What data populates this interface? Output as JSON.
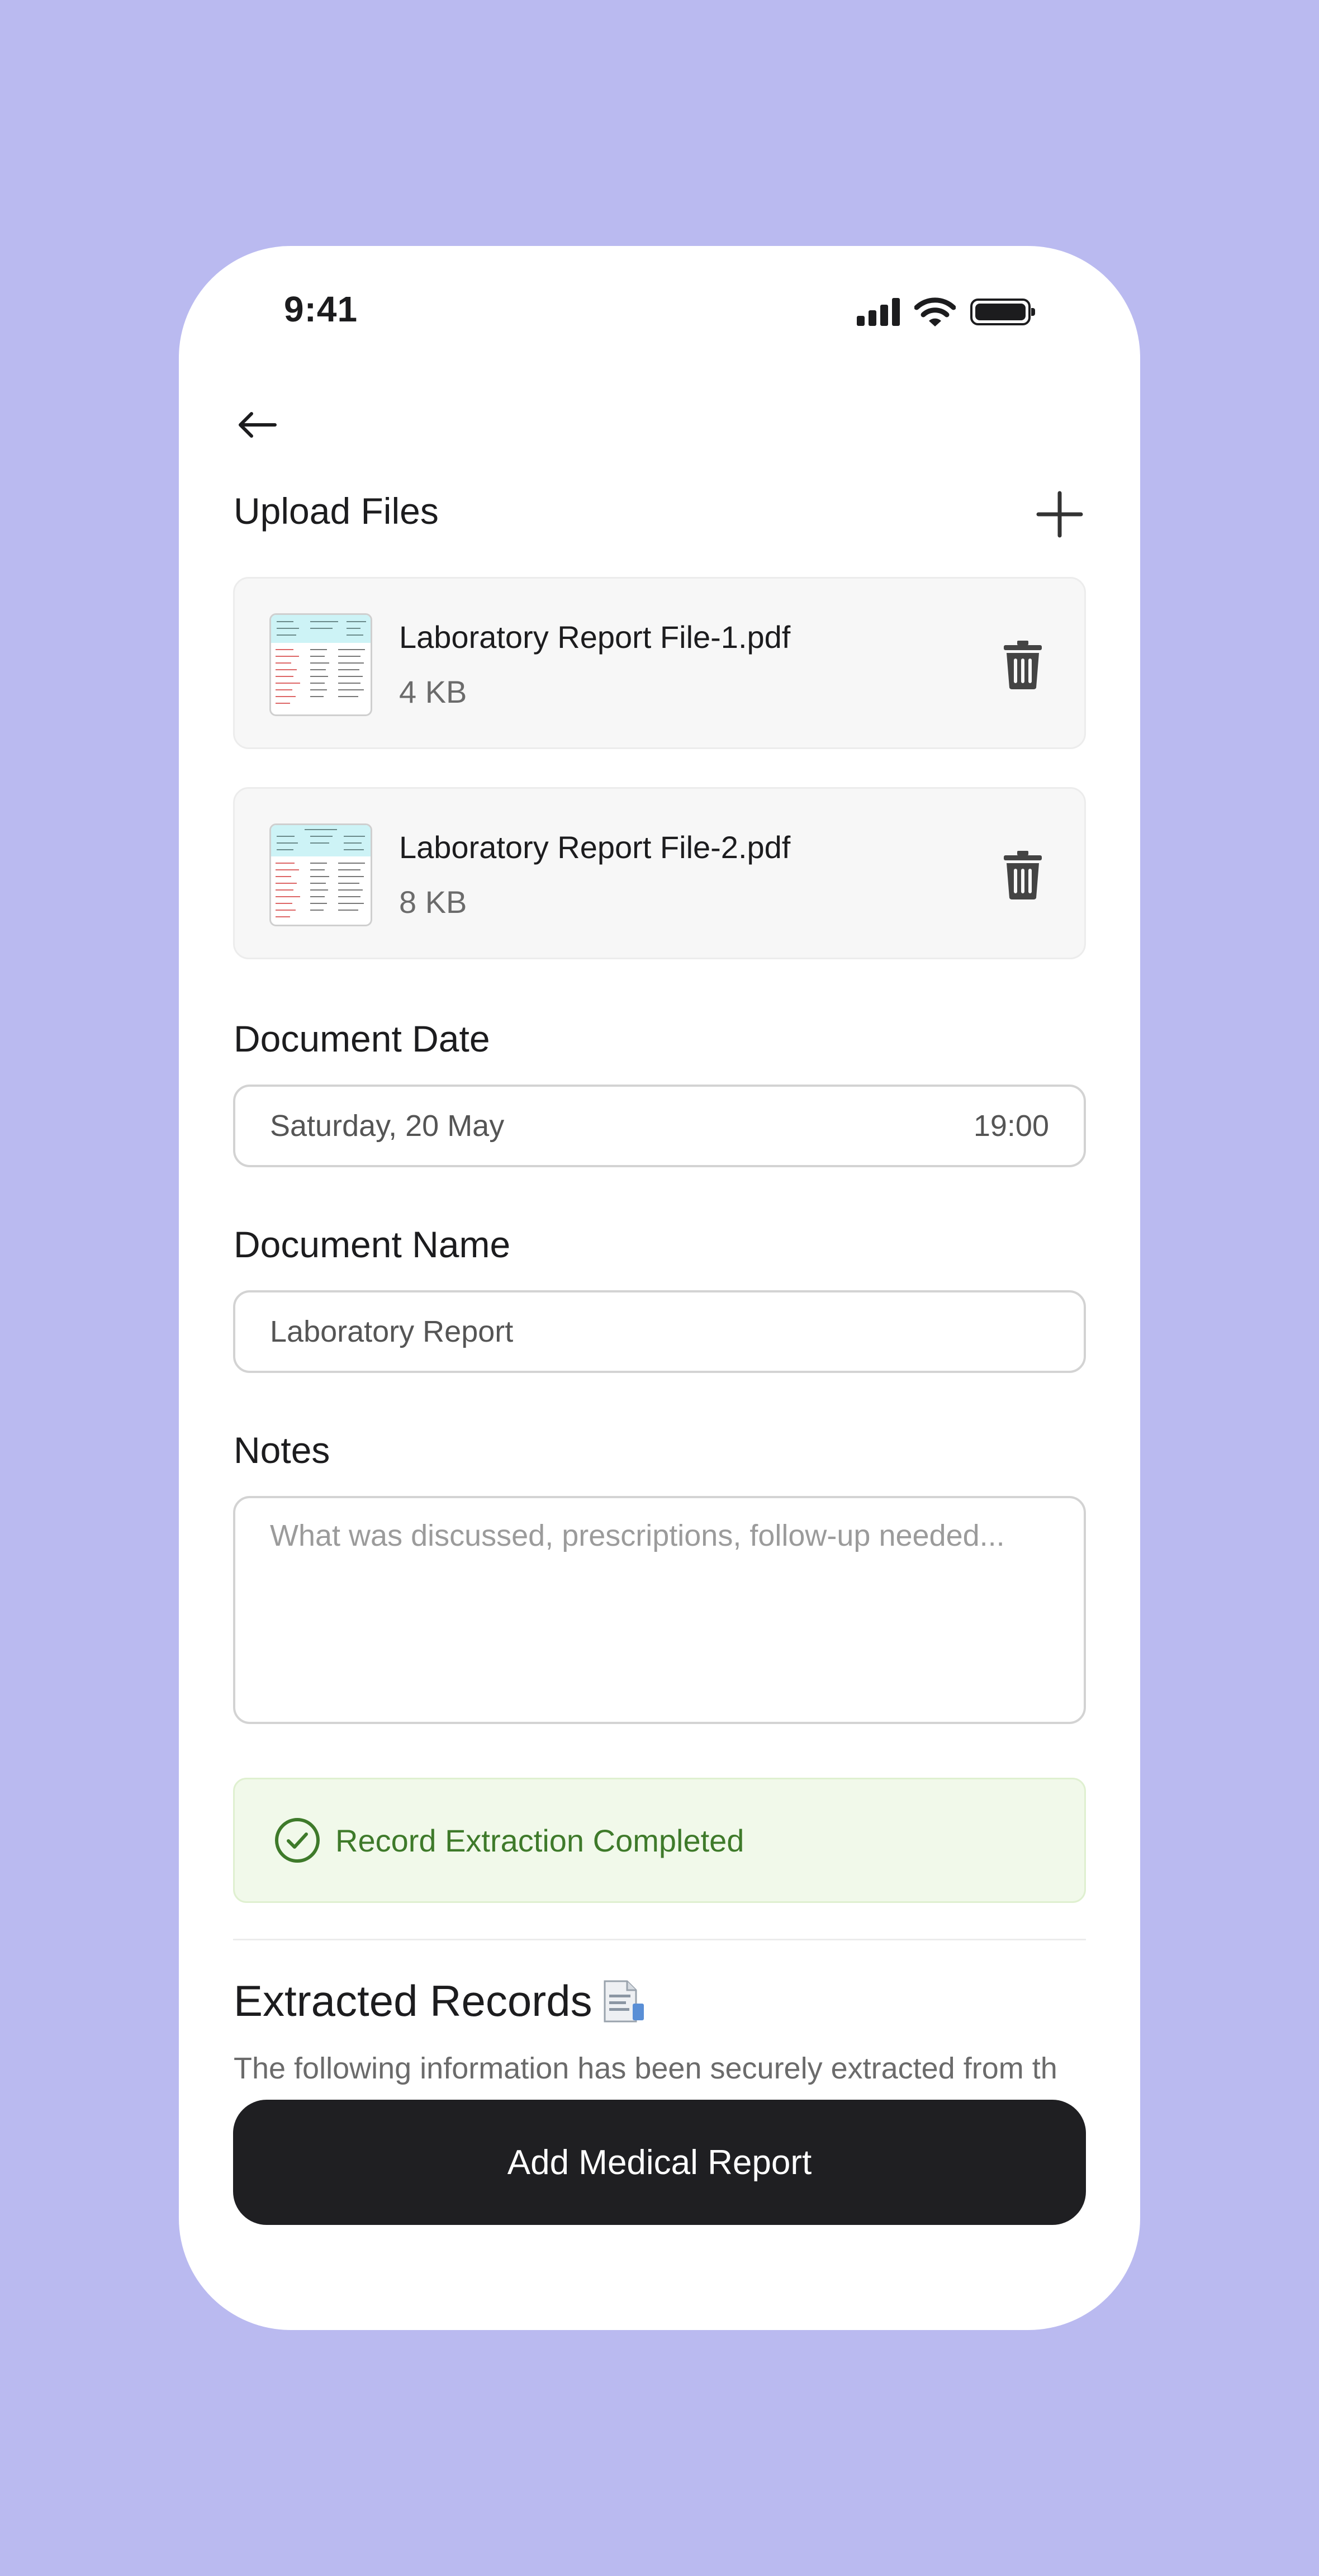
{
  "status_bar": {
    "time": "9:41"
  },
  "upload": {
    "title": "Upload Files",
    "files": [
      {
        "name": "Laboratory Report File-1.pdf",
        "size": "4 KB"
      },
      {
        "name": "Laboratory Report File-2.pdf",
        "size": "8 KB"
      }
    ]
  },
  "document_date": {
    "label": "Document Date",
    "date": "Saturday, 20 May",
    "time": "19:00"
  },
  "document_name": {
    "label": "Document Name",
    "value": "Laboratory Report"
  },
  "notes": {
    "label": "Notes",
    "placeholder": "What was discussed, prescriptions, follow-up needed..."
  },
  "extraction": {
    "status": "Record Extraction Completed"
  },
  "extracted_records": {
    "title": "Extracted Records",
    "description": "The following information has been securely extracted from th"
  },
  "cta": {
    "label": "Add Medical Report"
  },
  "colors": {
    "background": "#babaf0",
    "success_text": "#3e7a2a",
    "success_bg": "#f1f9ea",
    "cta_bg": "#1f1f22"
  }
}
